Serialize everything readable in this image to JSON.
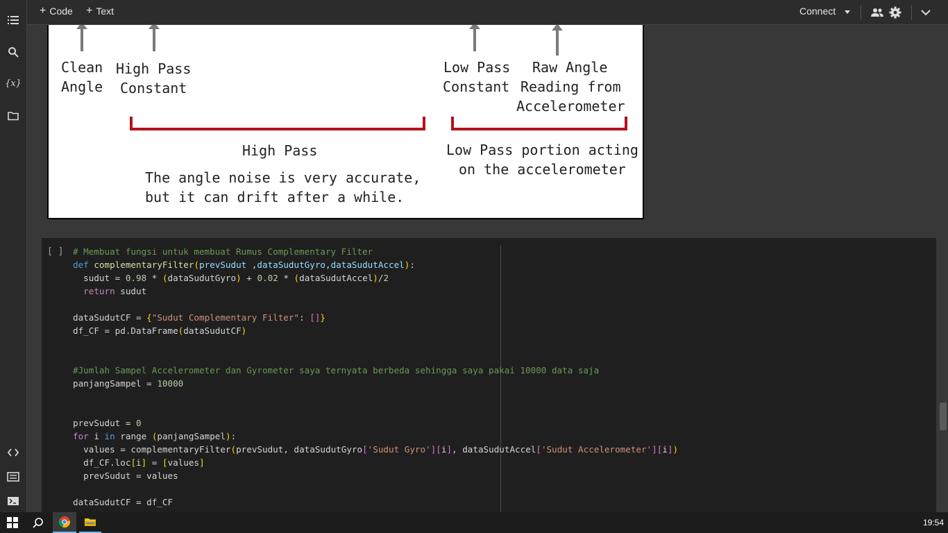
{
  "toolbar": {
    "add_code_label": "Code",
    "add_text_label": "Text",
    "connect_label": "Connect"
  },
  "sidebar": {
    "items": [
      {
        "icon": "toc-icon"
      },
      {
        "icon": "search-icon"
      },
      {
        "icon": "variables-icon",
        "label": "{x}"
      },
      {
        "icon": "folder-icon"
      }
    ],
    "bottom_items": [
      {
        "icon": "code-snippets-icon"
      },
      {
        "icon": "command-palette-icon"
      },
      {
        "icon": "terminal-icon"
      }
    ]
  },
  "figure": {
    "clean_angle": [
      "Clean",
      "Angle"
    ],
    "high_pass_constant": [
      "High Pass",
      "Constant"
    ],
    "low_pass_constant": [
      "Low Pass",
      "Constant"
    ],
    "raw_angle": [
      "Raw Angle",
      "Reading from",
      "Accelerometer"
    ],
    "high_pass_title": "High Pass",
    "high_pass_desc": [
      "The angle noise is very accurate,",
      "but it can drift after a while."
    ],
    "low_pass_desc": [
      "Low Pass portion acting",
      "on the accelerometer"
    ],
    "accent_color": "#b3121c"
  },
  "cell": {
    "run_label": "[ ]",
    "tokens": {
      "c1": "# Membuat fungsi untuk membuat Rumus Complementary Filter",
      "def": "def",
      "fn_name": "complementaryFilter",
      "p1": "prevSudut",
      "p2": "dataSudutGyro",
      "p3": "dataSudutAccel",
      "sudut": "sudut",
      "n098": "0.98",
      "n002": "0.02",
      "n2": "2",
      "ret": "return",
      "dscf": "dataSudutCF",
      "key_cf": "\"Sudut Complementary Filter\"",
      "dfcf": "df_CF",
      "pd_df": "pd.DataFrame",
      "c2": "#Jumlah Sampel Accelerometer dan Gyrometer saya ternyata berbeda sehingga saya pakai 10000 data saja",
      "panj": "panjangSampel",
      "n10000": "10000",
      "n0": "0",
      "kfor": "for",
      "vi": "i",
      "kin": "in",
      "krange": "range",
      "vals": "values",
      "s_gyro": "'Sudut Gyro'",
      "s_acc": "'Sudut Accelerometer'",
      "loc": ".loc"
    }
  },
  "taskbar": {
    "clock": "19:54"
  }
}
